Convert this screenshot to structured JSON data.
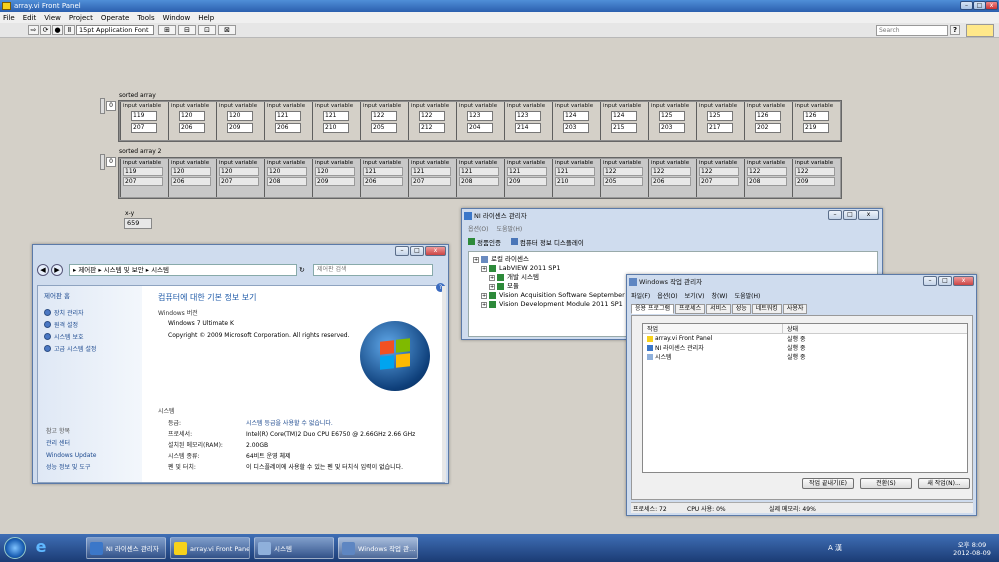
{
  "labview": {
    "title": "array.vi Front Panel",
    "menu": [
      "File",
      "Edit",
      "View",
      "Project",
      "Operate",
      "Tools",
      "Window",
      "Help"
    ],
    "font_selector": "15pt Application Font",
    "search_placeholder": "Search",
    "help_icon": "?",
    "sorted_array": {
      "label": "sorted array",
      "index": "0",
      "cells": [
        {
          "label": "input variable",
          "a": "119",
          "b": "207"
        },
        {
          "label": "input variable",
          "a": "120",
          "b": "206"
        },
        {
          "label": "input variable",
          "a": "120",
          "b": "209"
        },
        {
          "label": "input variable",
          "a": "121",
          "b": "206"
        },
        {
          "label": "input variable",
          "a": "121",
          "b": "210"
        },
        {
          "label": "input variable",
          "a": "122",
          "b": "205"
        },
        {
          "label": "input variable",
          "a": "122",
          "b": "212"
        },
        {
          "label": "input variable",
          "a": "123",
          "b": "204"
        },
        {
          "label": "input variable",
          "a": "123",
          "b": "214"
        },
        {
          "label": "input variable",
          "a": "124",
          "b": "203"
        },
        {
          "label": "input variable",
          "a": "124",
          "b": "215"
        },
        {
          "label": "input variable",
          "a": "125",
          "b": "203"
        },
        {
          "label": "input variable",
          "a": "125",
          "b": "217"
        },
        {
          "label": "input variable",
          "a": "126",
          "b": "202"
        },
        {
          "label": "input variable",
          "a": "126",
          "b": "219"
        }
      ]
    },
    "sorted_array_2": {
      "label": "sorted array 2",
      "index": "0",
      "cells": [
        {
          "label": "input variable",
          "a": "119",
          "b": "207"
        },
        {
          "label": "input variable",
          "a": "120",
          "b": "206"
        },
        {
          "label": "input variable",
          "a": "120",
          "b": "207"
        },
        {
          "label": "input variable",
          "a": "120",
          "b": "208"
        },
        {
          "label": "input variable",
          "a": "120",
          "b": "209"
        },
        {
          "label": "input variable",
          "a": "121",
          "b": "206"
        },
        {
          "label": "input variable",
          "a": "121",
          "b": "207"
        },
        {
          "label": "input variable",
          "a": "121",
          "b": "208"
        },
        {
          "label": "input variable",
          "a": "121",
          "b": "209"
        },
        {
          "label": "input variable",
          "a": "121",
          "b": "210"
        },
        {
          "label": "input variable",
          "a": "122",
          "b": "205"
        },
        {
          "label": "input variable",
          "a": "122",
          "b": "206"
        },
        {
          "label": "input variable",
          "a": "122",
          "b": "207"
        },
        {
          "label": "input variable",
          "a": "122",
          "b": "208"
        },
        {
          "label": "input variable",
          "a": "122",
          "b": "209"
        }
      ]
    },
    "xy": {
      "label": "x-y",
      "value": "659"
    }
  },
  "system_window": {
    "breadcrumb": "▸ 제어판 ▸ 시스템 및 보안 ▸ 시스템",
    "search_placeholder": "제어판 검색",
    "left_title": "제어판 홈",
    "left_links": [
      "장치 관리자",
      "원격 설정",
      "시스템 보호",
      "고급 시스템 설정"
    ],
    "see_also_title": "참고 항목",
    "see_also": [
      "관리 센터",
      "Windows Update",
      "성능 정보 및 도구"
    ],
    "heading": "컴퓨터에 대한 기본 정보 보기",
    "edition_title": "Windows 버전",
    "edition": "Windows 7 Ultimate K",
    "copyright": "Copyright © 2009 Microsoft Corporation. All rights reserved.",
    "system_title": "시스템",
    "rows": [
      {
        "k": "등급:",
        "v": "시스템 등급을 사용할 수 없습니다."
      },
      {
        "k": "프로세서:",
        "v": "Intel(R) Core(TM)2 Duo CPU     E6750  @ 2.66GHz   2.66 GHz"
      },
      {
        "k": "설치된 메모리(RAM):",
        "v": "2.00GB"
      },
      {
        "k": "시스템 종류:",
        "v": "64비트 운영 체제"
      },
      {
        "k": "펜 및 터치:",
        "v": "이 디스플레이에 사용할 수 있는 펜 및 터치식 입력이 없습니다."
      }
    ],
    "help_icon": "?"
  },
  "ni_license": {
    "title": "NI 라이센스 관리자",
    "menu": [
      "옵션(O)",
      "도움말(H)"
    ],
    "toolbar": [
      "정품인증",
      "컴퓨터 정보 디스플레이"
    ],
    "tree": [
      {
        "text": "로컬 라이센스",
        "indent": 0
      },
      {
        "text": "LabVIEW 2011 SP1",
        "indent": 1
      },
      {
        "text": "개발 시스템",
        "indent": 2
      },
      {
        "text": "모듈",
        "indent": 2
      },
      {
        "text": "Vision Acquisition Software September 2011",
        "indent": 1
      },
      {
        "text": "Vision Development Module 2011 SP1",
        "indent": 1
      }
    ]
  },
  "task_manager": {
    "title": "Windows 작업 관리자",
    "menu": [
      "파일(F)",
      "옵션(O)",
      "보기(V)",
      "창(W)",
      "도움말(H)"
    ],
    "tabs": [
      "응용 프로그램",
      "프로세스",
      "서비스",
      "성능",
      "네트워킹",
      "사용자"
    ],
    "col_task": "작업",
    "col_status": "상태",
    "rows": [
      {
        "task": "array.vi Front Panel",
        "status": "실행 중"
      },
      {
        "task": "NI 라이센스 관리자",
        "status": "실행 중"
      },
      {
        "task": "시스템",
        "status": "실행 중"
      }
    ],
    "buttons": [
      "작업 끝내기(E)",
      "전환(S)",
      "새 작업(N)..."
    ],
    "status_processes": "프로세스: 72",
    "status_cpu": "CPU 사용: 0%",
    "status_mem": "실제 메모리: 49%"
  },
  "taskbar": {
    "items": [
      "NI 라이센스 관리자",
      "array.vi Front Panel",
      "시스템",
      "Windows 작업 관..."
    ],
    "ime": "A 漢",
    "time": "오후 8:09",
    "date": "2012-08-09"
  },
  "colors": {
    "titlebar": "#2b5fae",
    "panel_bg": "#d4d0c8",
    "taskbar": "#1b3b74",
    "link": "#1d4a8f",
    "heading": "#1e5aa8"
  }
}
